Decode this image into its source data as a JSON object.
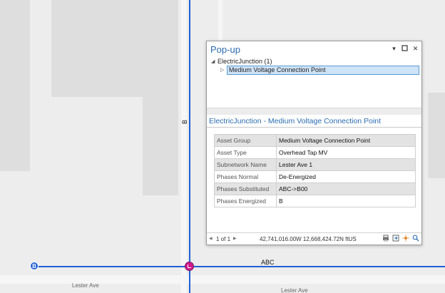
{
  "map": {
    "line_label_vertical": "B",
    "line_label_horizontal": "ABC",
    "node_label": "B",
    "streets": [
      "Lester Ave",
      "Lester Ave"
    ]
  },
  "popup": {
    "title": "Pop-up",
    "tree": {
      "parent": "ElectricJunction (1)",
      "child": "Medium Voltage Connection Point"
    },
    "section_title": "ElectricJunction - Medium Voltage Connection Point",
    "attributes": [
      {
        "key": "Asset Group",
        "value": "Medium Voltage Connection Point"
      },
      {
        "key": "Asset Type",
        "value": "Overhead Tap MV"
      },
      {
        "key": "Subnetwork Name",
        "value": "Lester Ave 1"
      },
      {
        "key": "Phases Normal",
        "value": "De-Energized"
      },
      {
        "key": "Phases Substituted",
        "value": "ABC->B00"
      },
      {
        "key": "Phases Energized",
        "value": "B"
      }
    ],
    "footer": {
      "page": "1 of 1",
      "coordinates": "42,741,016.00W 12,668,424.72N ftUS"
    }
  },
  "colors": {
    "accent": "#2b6cb0",
    "line": "#1f5fd6",
    "junction": "#d01a8c"
  },
  "icons": [
    "minimize-icon",
    "maximize-icon",
    "close-icon",
    "print-icon",
    "export-icon",
    "flash-icon",
    "zoom-to-icon"
  ]
}
